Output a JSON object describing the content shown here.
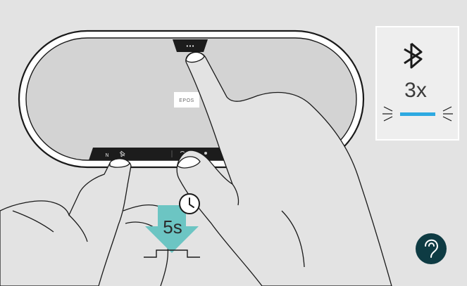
{
  "device": {
    "brand": "EPOS",
    "top_button_symbol": "•••"
  },
  "instruction": {
    "hold_duration": "5s",
    "clock_icon": "clock-icon",
    "arrow_icon": "arrow-down-icon"
  },
  "indicator": {
    "icon": "bluetooth-icon",
    "blink_count": "3x",
    "led_color": "#2da9e1"
  },
  "help": {
    "icon": "ear-help-icon",
    "color": "#0e3b43"
  },
  "colors": {
    "background": "#e3e3e3",
    "arrow": "#6cc5c3",
    "device_body": "#d3d3d3",
    "control_bar": "#1c1c1c"
  }
}
